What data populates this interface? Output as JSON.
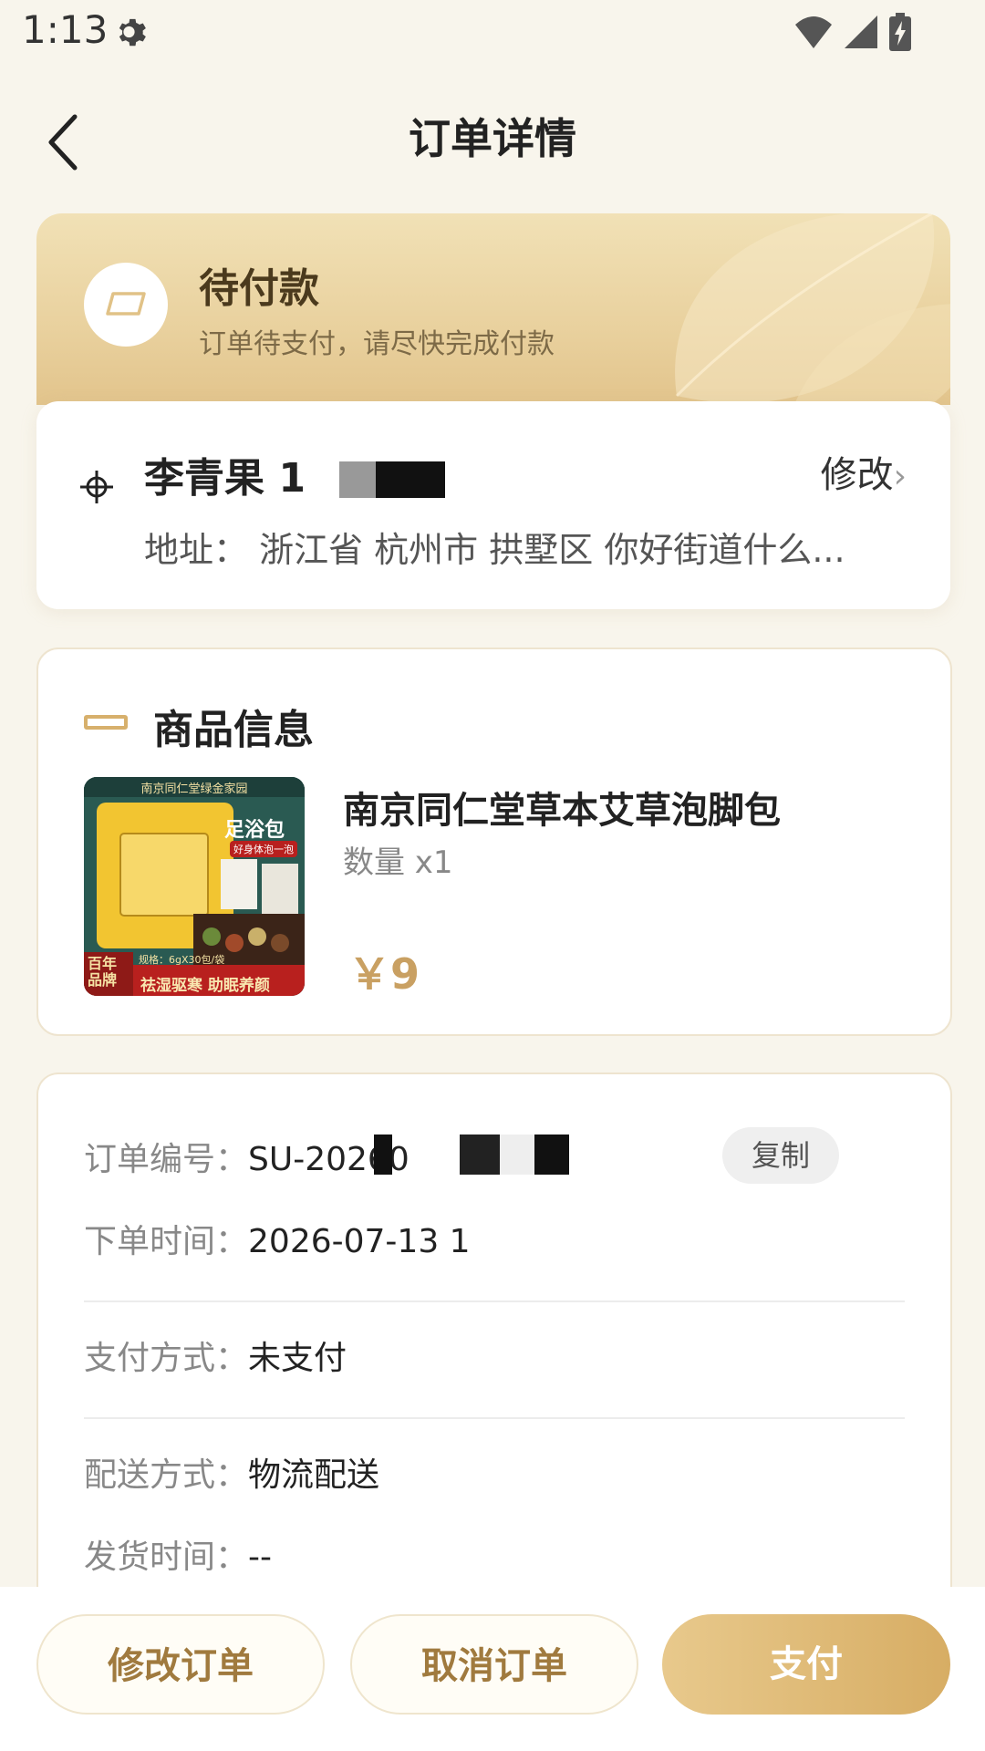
{
  "status_bar": {
    "time": "1:13"
  },
  "header": {
    "title": "订单详情"
  },
  "order_status": {
    "title": "待付款",
    "subtitle": "订单待支付，请尽快完成付款"
  },
  "address": {
    "name": "李青果 18",
    "edit_label": "修改",
    "edit_chevron": "›",
    "line": "地址：  浙江省 杭州市 拱墅区 你好街道什么..."
  },
  "goods": {
    "heading": "商品信息",
    "name": "南京同仁堂草本艾草泡脚包",
    "quantity": "数量 x1",
    "price": "￥9",
    "thumb": {
      "brand": "南京同仁堂绿金家园",
      "title": "足浴包",
      "subtitle": "好身体泡一泡",
      "spec": "规格：6gX30包/袋",
      "badge": "百年品牌",
      "slogan": "祛湿驱寒  助眠养颜"
    }
  },
  "order_info": {
    "order_no_label": "订单编号：",
    "order_no_value": "SU-20260",
    "copy_label": "复制",
    "order_time_label": "下单时间：",
    "order_time_value": "2026-07-13 1",
    "pay_method_label": "支付方式：",
    "pay_method_value": "未支付",
    "delivery_label": "配送方式：",
    "delivery_value": "物流配送",
    "ship_time_label": "发货时间：",
    "ship_time_value": "--"
  },
  "actions": {
    "modify": "修改订单",
    "cancel": "取消订单",
    "pay": "支付"
  },
  "colors": {
    "accent": "#d7ad64",
    "price": "#c9a062",
    "background": "#f8f5ec"
  }
}
